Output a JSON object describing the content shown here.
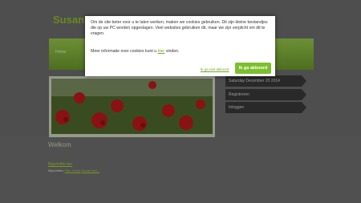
{
  "site": {
    "title": "Susan",
    "subtitle": "",
    "nav_items": [
      "Home"
    ]
  },
  "sidebar": {
    "items": [
      "Saturday December 20 2014",
      "Registreren",
      "Inloggen"
    ]
  },
  "main": {
    "heading": "Welkom",
    "links_heading": "Bijschrifte ten",
    "links_text": "Bijschriften",
    "links_link1": "Hier 3 links",
    "links_link2": "Susan met..."
  },
  "cookie_modal": {
    "text1": "Om de site beter voor u te laten werken, maken we cookies gebruiken. Dit zijn kleine bestandjes die op uw PC worden opgeslagen. Veel websites gebruiken dit, maar we zijn verplicht om dit te vragen.",
    "text2_prefix": "Meer informatie over cookies kunt u",
    "text2_link": "hier",
    "text2_suffix": "vinden.",
    "decline_label": "Ik ga niet akkoord",
    "accept_label": "Ik ga akkoord"
  },
  "colors": {
    "accent": "#7cbf2e",
    "link": "#74a62a"
  }
}
